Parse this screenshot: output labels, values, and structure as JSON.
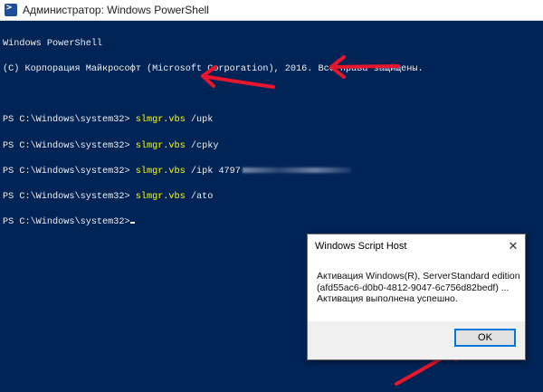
{
  "window": {
    "title": "Администратор: Windows PowerShell",
    "icon": "powershell-icon"
  },
  "console": {
    "header_lines": [
      "Windows PowerShell",
      "(C) Корпорация Майкрософт (Microsoft Corporation), 2016. Все права защищены."
    ],
    "commands": [
      {
        "prompt": "PS C:\\Windows\\system32> ",
        "cmd": "slmgr.vbs",
        "args": " /upk"
      },
      {
        "prompt": "PS C:\\Windows\\system32> ",
        "cmd": "slmgr.vbs",
        "args": " /cpky"
      },
      {
        "prompt": "PS C:\\Windows\\system32> ",
        "cmd": "slmgr.vbs",
        "args": " /ipk 4797"
      },
      {
        "prompt": "PS C:\\Windows\\system32> ",
        "cmd": "slmgr.vbs",
        "args": " /ato"
      }
    ],
    "current_prompt": "PS C:\\Windows\\system32>",
    "colors": {
      "background": "#012456",
      "text": "#eeedf0",
      "command": "#ffff00"
    }
  },
  "dialog": {
    "title": "Windows Script Host",
    "close_icon": "close-icon",
    "message_line1": "Активация Windows(R), ServerStandard edition",
    "message_line2": "(afd55ac6-d0b0-4812-9047-6c756d82bedf) ...",
    "message_line3": "Активация выполнена успешно.",
    "ok_label": "OK"
  },
  "annotations": {
    "color": "#e8162c"
  }
}
